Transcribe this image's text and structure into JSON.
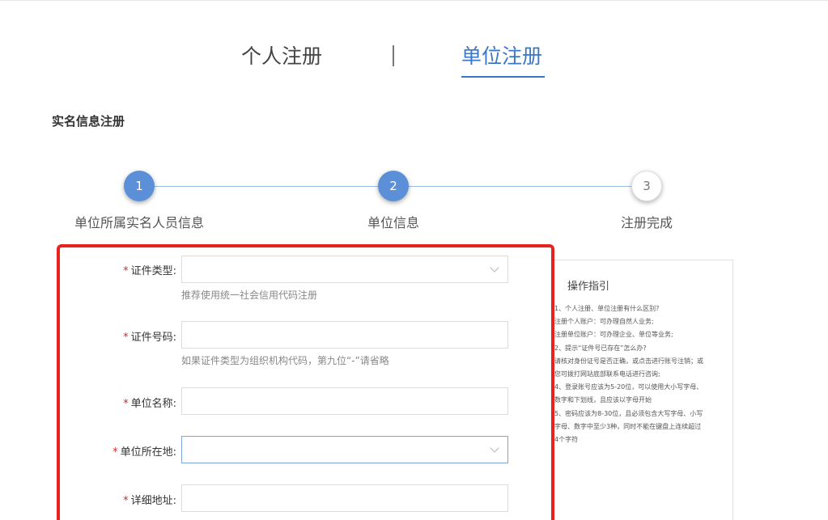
{
  "tabs": {
    "personal": "个人注册",
    "unit": "单位注册"
  },
  "section_title": "实名信息注册",
  "steps": [
    {
      "num": "1",
      "label": "单位所属实名人员信息",
      "state": "active"
    },
    {
      "num": "2",
      "label": "单位信息",
      "state": "active"
    },
    {
      "num": "3",
      "label": "注册完成",
      "state": "inactive"
    }
  ],
  "form": {
    "cert_type": {
      "label": "证件类型:",
      "required": "*",
      "value": "",
      "hint": "推荐使用统一社会信用代码注册"
    },
    "cert_number": {
      "label": "证件号码:",
      "required": "*",
      "value": "",
      "hint": "如果证件类型为组织机构代码，第九位“-”请省略"
    },
    "unit_name": {
      "label": "单位名称:",
      "required": "*",
      "value": ""
    },
    "unit_location": {
      "label": "单位所在地:",
      "required": "*",
      "value": ""
    },
    "address": {
      "label": "详细地址:",
      "required": "*",
      "value": ""
    }
  },
  "guide": {
    "title": "操作指引",
    "lines": [
      "1、个人注册、单位注册有什么区别?",
      "注册个人账户：可办理自然人业务;",
      "注册单位账户：可办理企业、单位等业务;",
      "2、提示“证件号已存在”怎么办?",
      "请核对身份证号是否正确，或点击进行账号注销；或",
      "您可拨打网站底部联系电话进行咨询;",
      "4、登录账号应该为5-20位，可以使用大小写字母、",
      "数字和下划线，且应该以字母开始",
      "5、密码应该为8-30位，且必须包含大写字母、小写",
      "字母、数字中至少3种，同时不能在键盘上连续超过",
      "4个字符"
    ]
  },
  "colors": {
    "accent": "#3a78c7",
    "step_active": "#5b8fd8",
    "highlight_border": "#e8231d",
    "required": "#d9272e"
  }
}
